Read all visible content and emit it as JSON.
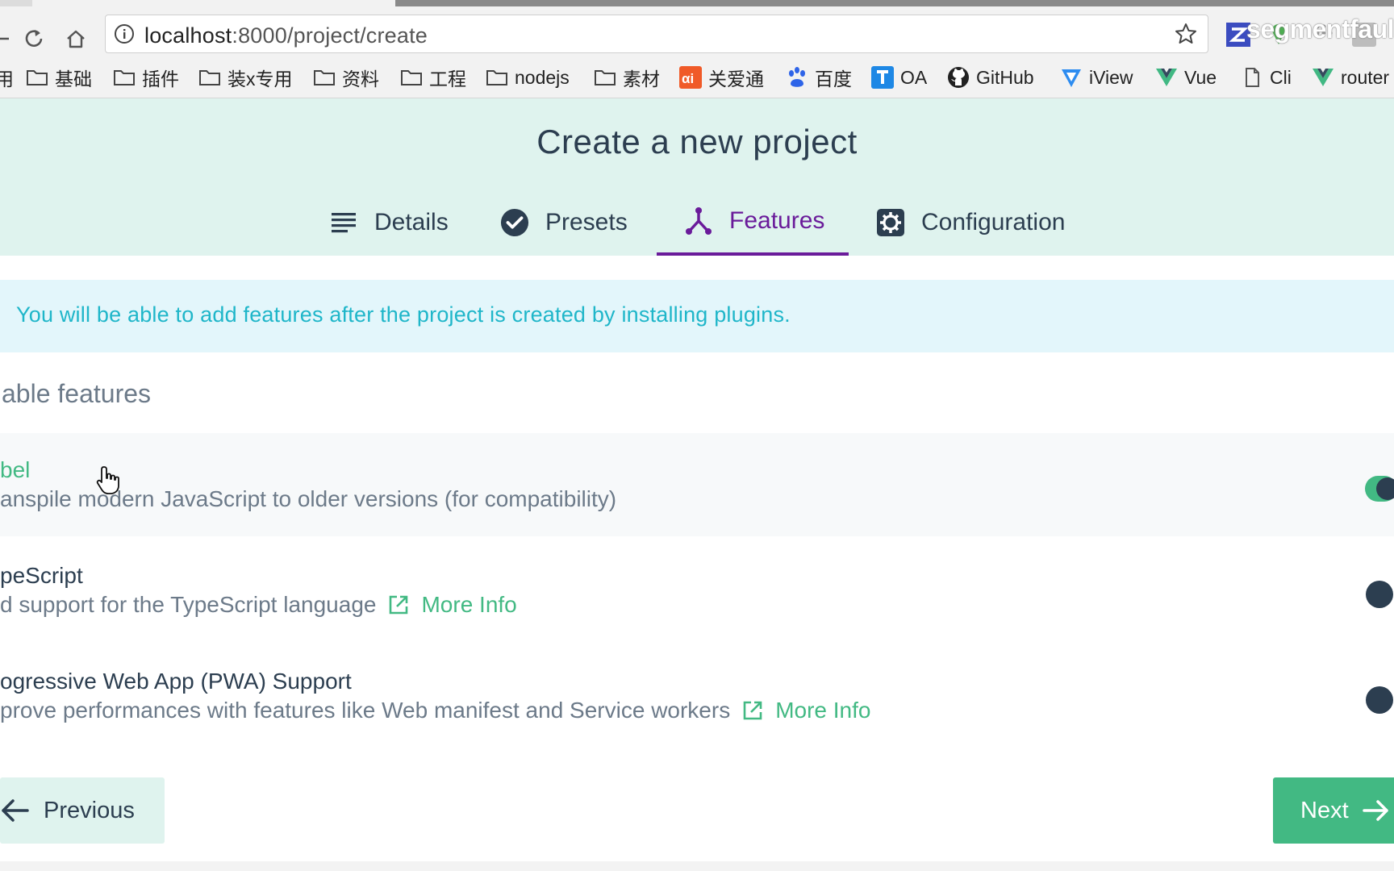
{
  "browser": {
    "url_host": "localhost",
    "url_path": ":8000/project/create",
    "watermark": "segmentfaul",
    "bookmarks": [
      {
        "label": "基础",
        "icon": "folder-icon"
      },
      {
        "label": "插件",
        "icon": "folder-icon"
      },
      {
        "label": "装x专用",
        "icon": "folder-icon"
      },
      {
        "label": "资料",
        "icon": "folder-icon"
      },
      {
        "label": "工程",
        "icon": "folder-icon"
      },
      {
        "label": "nodejs",
        "icon": "folder-icon"
      },
      {
        "label": "素材",
        "icon": "folder-icon"
      },
      {
        "label": "关爱通",
        "icon": "ai-logo-icon"
      },
      {
        "label": "百度",
        "icon": "baidu-paw-icon"
      },
      {
        "label": "OA",
        "icon": "t-logo-icon"
      },
      {
        "label": "GitHub",
        "icon": "github-icon"
      },
      {
        "label": "iView",
        "icon": "iview-icon"
      },
      {
        "label": "Vue",
        "icon": "vue-icon"
      },
      {
        "label": "Cli",
        "icon": "page-icon"
      },
      {
        "label": "router",
        "icon": "vue-icon"
      }
    ],
    "bookmark_prefix": "用"
  },
  "page": {
    "title": "Create a new project",
    "steps": [
      {
        "label": "Details",
        "icon": "list-icon"
      },
      {
        "label": "Presets",
        "icon": "check-circle-icon"
      },
      {
        "label": "Features",
        "icon": "branch-icon"
      },
      {
        "label": "Configuration",
        "icon": "gear-icon"
      }
    ],
    "active_step": "Features",
    "info_banner": "You will be able to add features after the project is created by installing plugins.",
    "section_title": "able features",
    "features": [
      {
        "name": "bel",
        "description": "anspile modern JavaScript to older versions (for compatibility)",
        "more_info": "",
        "enabled": true
      },
      {
        "name": "peScript",
        "description": "d support for the TypeScript language",
        "more_info": "More Info",
        "enabled": false
      },
      {
        "name": "ogressive Web App (PWA) Support",
        "description": "prove performances with features like Web manifest and Service workers",
        "more_info": "More Info",
        "enabled": false
      }
    ],
    "previous_label": "Previous",
    "next_label": "Next"
  },
  "colors": {
    "accent_green": "#42b983",
    "header_bg": "#dff3ee",
    "active_step": "#6a1b9a",
    "banner_text": "#1fb6c9",
    "dark_text": "#2c3e50"
  }
}
